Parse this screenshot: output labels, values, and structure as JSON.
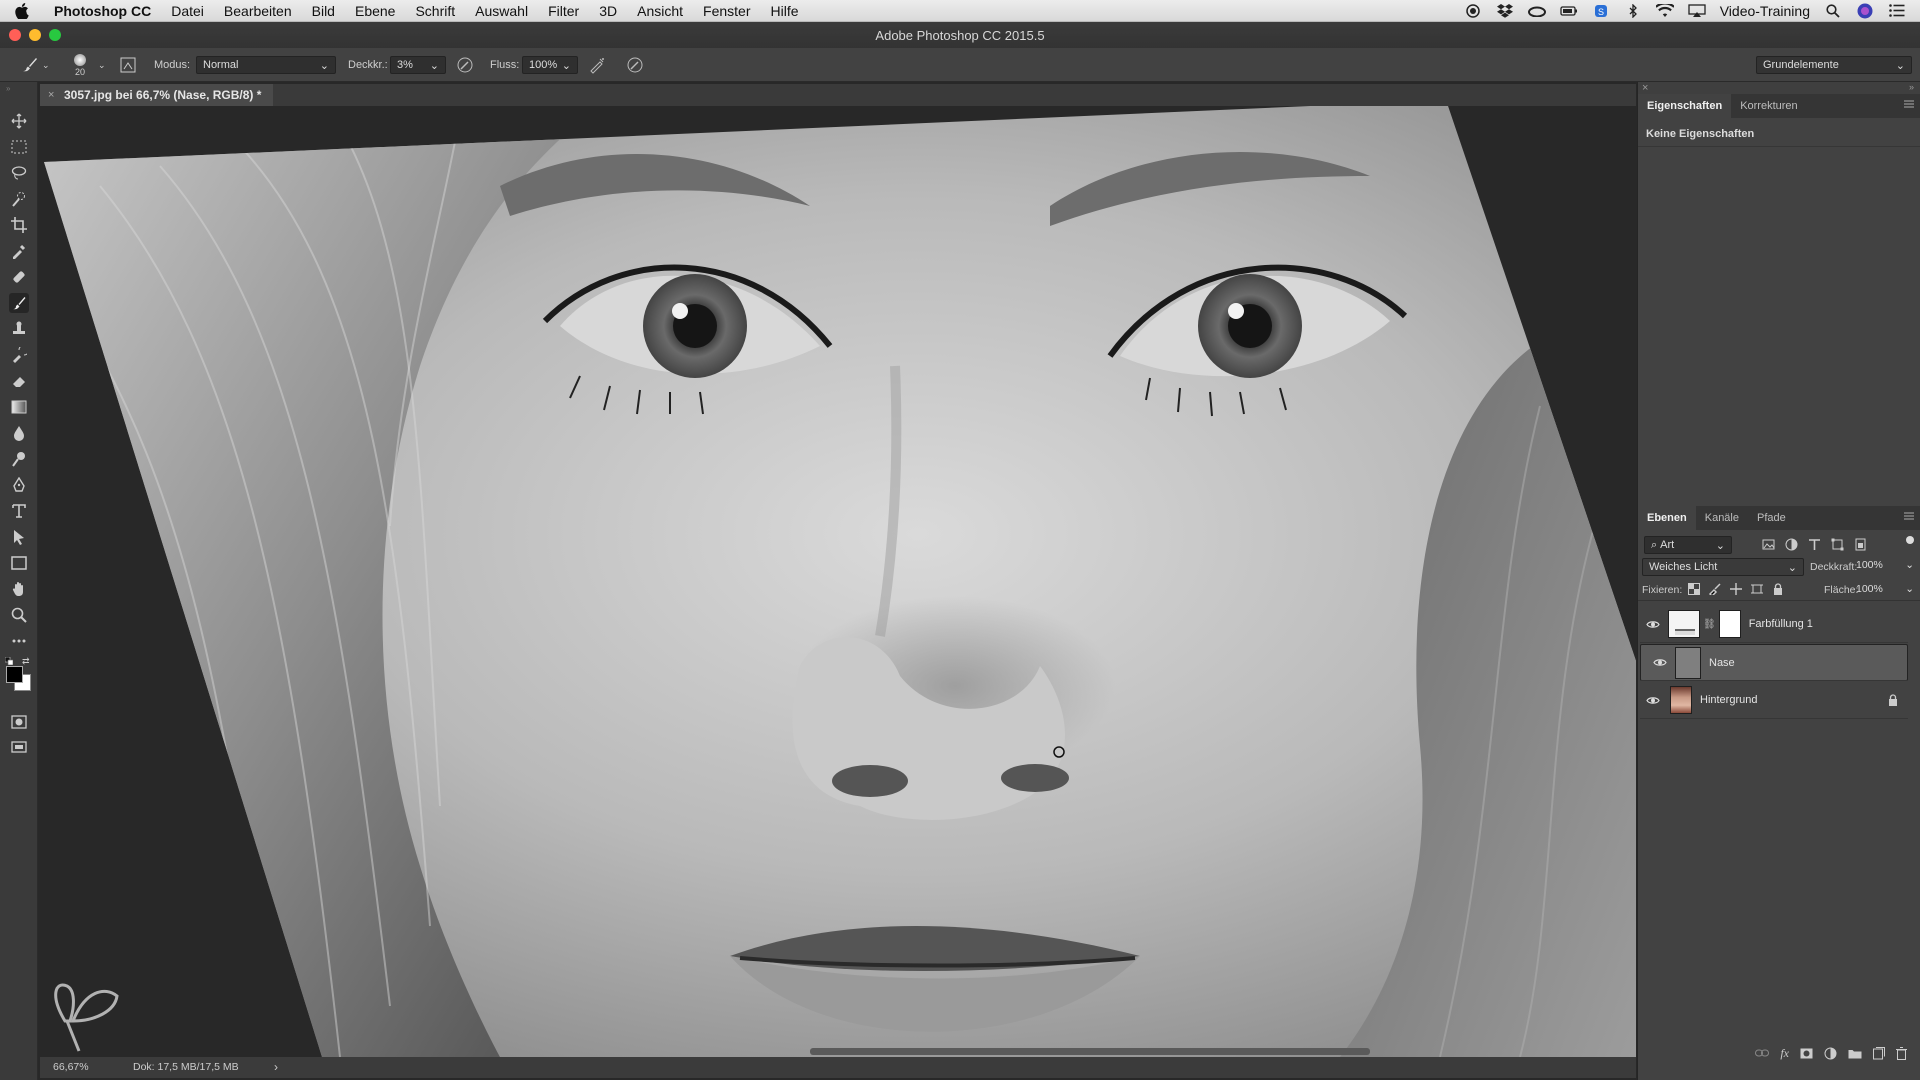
{
  "menubar": {
    "app_name": "Photoshop CC",
    "items": [
      "Datei",
      "Bearbeiten",
      "Bild",
      "Ebene",
      "Schrift",
      "Auswahl",
      "Filter",
      "3D",
      "Ansicht",
      "Fenster",
      "Hilfe"
    ],
    "user": "Video-Training"
  },
  "window": {
    "title": "Adobe Photoshop CC 2015.5"
  },
  "options": {
    "brush_size": "20",
    "mode_label": "Modus:",
    "mode_value": "Normal",
    "opacity_label": "Deckkr.:",
    "opacity_value": "3%",
    "flow_label": "Fluss:",
    "flow_value": "100%",
    "workspace": "Grundelemente"
  },
  "document": {
    "tab_title": "3057.jpg bei 66,7% (Nase, RGB/8) *",
    "zoom": "66,67%",
    "doc_info": "Dok: 17,5 MB/17,5 MB"
  },
  "properties": {
    "tabs": [
      "Eigenschaften",
      "Korrekturen"
    ],
    "empty_text": "Keine Eigenschaften"
  },
  "layers_panel": {
    "tabs": [
      "Ebenen",
      "Kanäle",
      "Pfade"
    ],
    "filter_kind": "Art",
    "blend_mode": "Weiches Licht",
    "opacity_label": "Deckkraft:",
    "opacity_value": "100%",
    "lock_label": "Fixieren:",
    "fill_label": "Fläche:",
    "fill_value": "100%",
    "layers": [
      {
        "name": "Farbfüllung 1",
        "visible": true,
        "selected": false
      },
      {
        "name": "Nase",
        "visible": true,
        "selected": true
      },
      {
        "name": "Hintergrund",
        "visible": true,
        "selected": false,
        "locked": true
      }
    ]
  },
  "colors": {
    "accent_red": "#ff5f57",
    "accent_yellow": "#febc2e",
    "accent_green": "#28c840"
  }
}
